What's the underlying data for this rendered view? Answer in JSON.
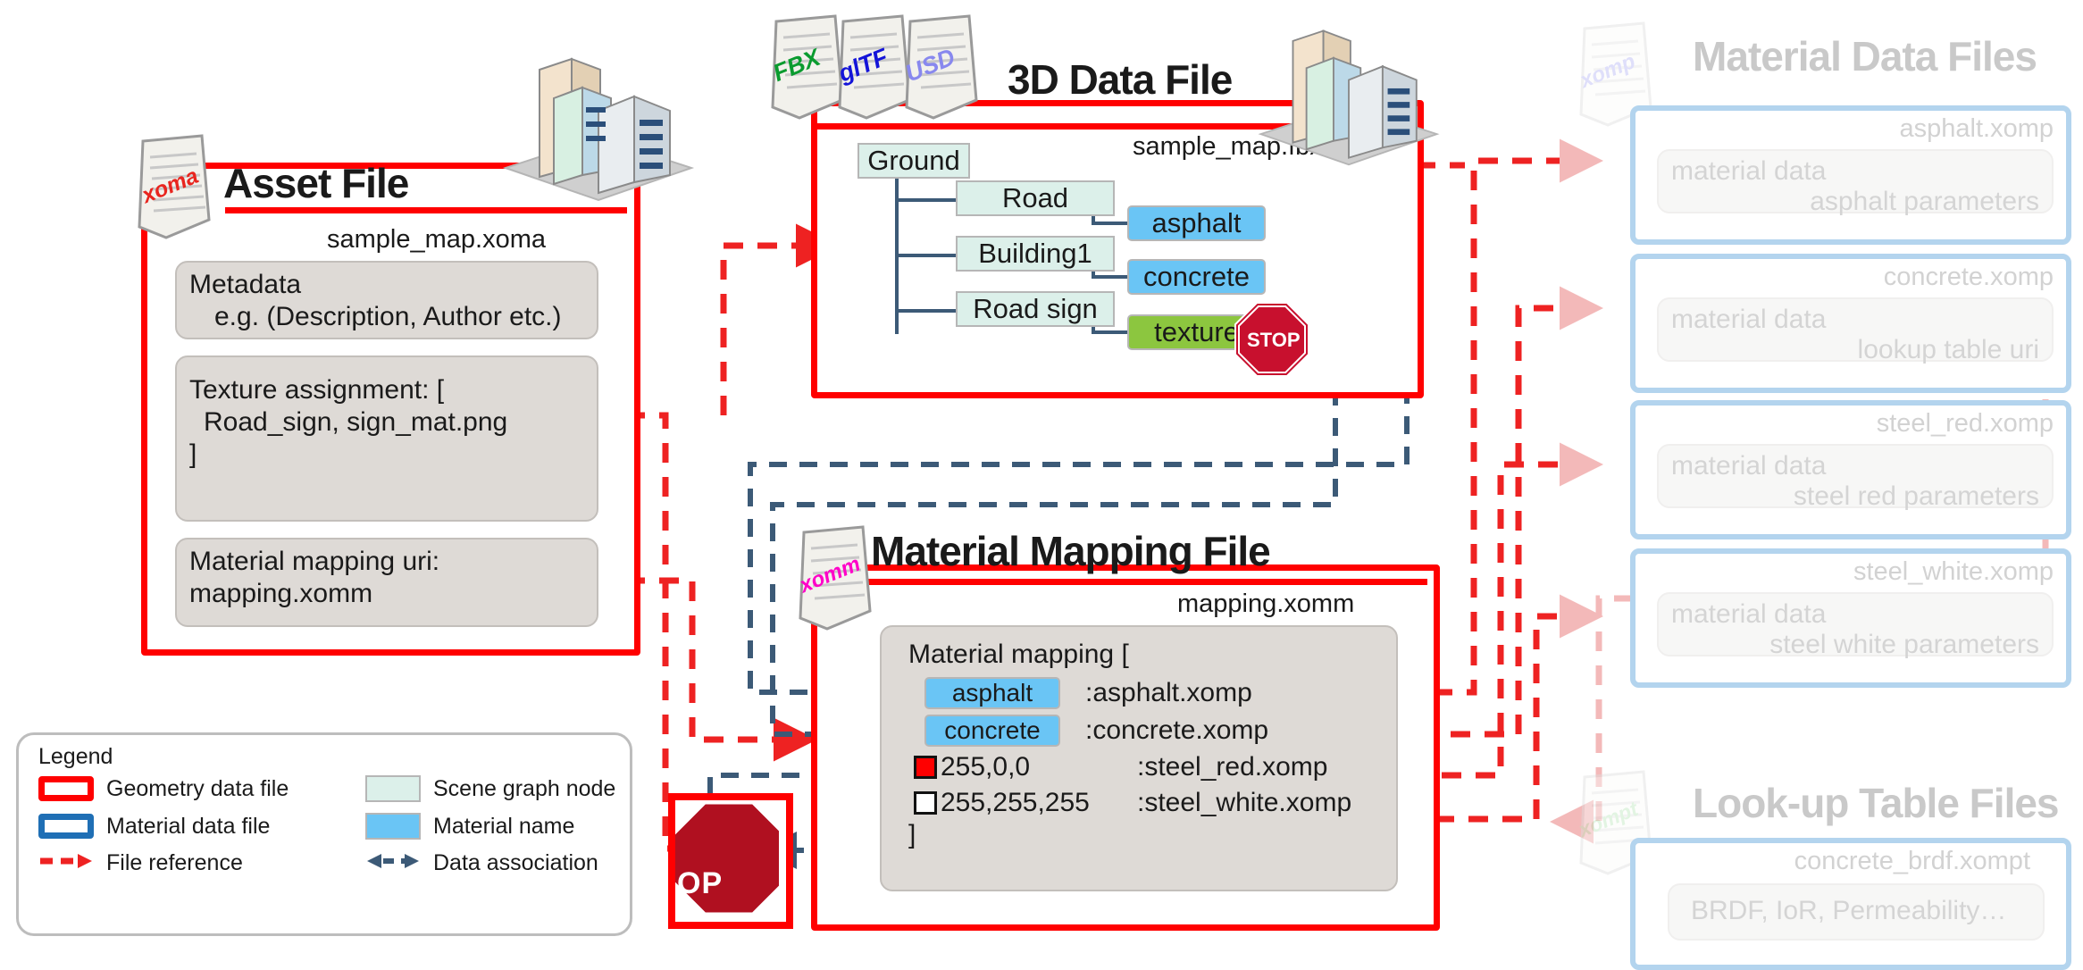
{
  "asset_file": {
    "title": "Asset File",
    "filename": "sample_map.xoma",
    "icon_tag": "xoma",
    "boxes": [
      {
        "line1": "Metadata",
        "line2": "e.g. (Description, Author etc.)"
      },
      {
        "line1": "Texture assignment: [",
        "line2": "Road_sign, sign_mat.png",
        "line3": "]"
      },
      {
        "line1": "Material mapping uri:",
        "line2": "mapping.xomm"
      }
    ]
  },
  "data_file": {
    "title": "3D Data File",
    "filename": "sample_map.fbx",
    "format_icons": [
      "FBX",
      "glTF",
      "USD"
    ],
    "scene_graph": {
      "root": "Ground",
      "children": [
        "Road",
        "Building1",
        "Road sign"
      ],
      "materials": [
        "asphalt",
        "concrete"
      ],
      "texture": "texture",
      "texture_badge": "STOP"
    }
  },
  "mapping_file": {
    "title": "Material Mapping File",
    "filename": "mapping.xomm",
    "icon_tag": "xomm",
    "list_open": "Material mapping [",
    "list_close": "]",
    "entries": [
      {
        "key": "asphalt",
        "kind": "material",
        "sep": ": ",
        "value": "asphalt.xomp"
      },
      {
        "key": "concrete",
        "kind": "material",
        "sep": ": ",
        "value": "concrete.xomp"
      },
      {
        "key": "255,0,0",
        "kind": "color",
        "swatch": "#ff0000",
        "sep": ": ",
        "value": "steel_red.xomp"
      },
      {
        "key": "255,255,255",
        "kind": "color",
        "swatch": "#ffffff",
        "sep": ": ",
        "value": "steel_white.xomp"
      }
    ]
  },
  "material_data_files": {
    "title": "Material Data Files",
    "icon_tag": "xomp",
    "files": [
      {
        "name": "asphalt.xomp",
        "line1": "material data",
        "line2": "asphalt parameters"
      },
      {
        "name": "concrete.xomp",
        "line1": "material data",
        "line2": "lookup table uri"
      },
      {
        "name": "steel_red.xomp",
        "line1": "material data",
        "line2": "steel red parameters"
      },
      {
        "name": "steel_white.xomp",
        "line1": "material data",
        "line2": "steel white parameters"
      }
    ]
  },
  "lookup_table_files": {
    "title": "Look-up Table Files",
    "icon_tag": "xompt",
    "files": [
      {
        "name": "concrete_brdf.xompt",
        "line1": "BRDF, IoR, Permeability…"
      }
    ]
  },
  "legend": {
    "title": "Legend",
    "items": [
      {
        "label": "Geometry data file"
      },
      {
        "label": "Material data file"
      },
      {
        "label": "File reference"
      },
      {
        "label": "Scene graph node"
      },
      {
        "label": "Material name"
      },
      {
        "label": "Data association"
      }
    ]
  },
  "colors": {
    "geometry_red": "#ff0000",
    "material_blue": "#1f6fb5",
    "scene_node": "#dcf0ea",
    "material_name": "#6ac5f5",
    "texture_green": "#8cc63f",
    "data_assoc": "#3c5a77",
    "ghost": "#d4d4d4"
  }
}
